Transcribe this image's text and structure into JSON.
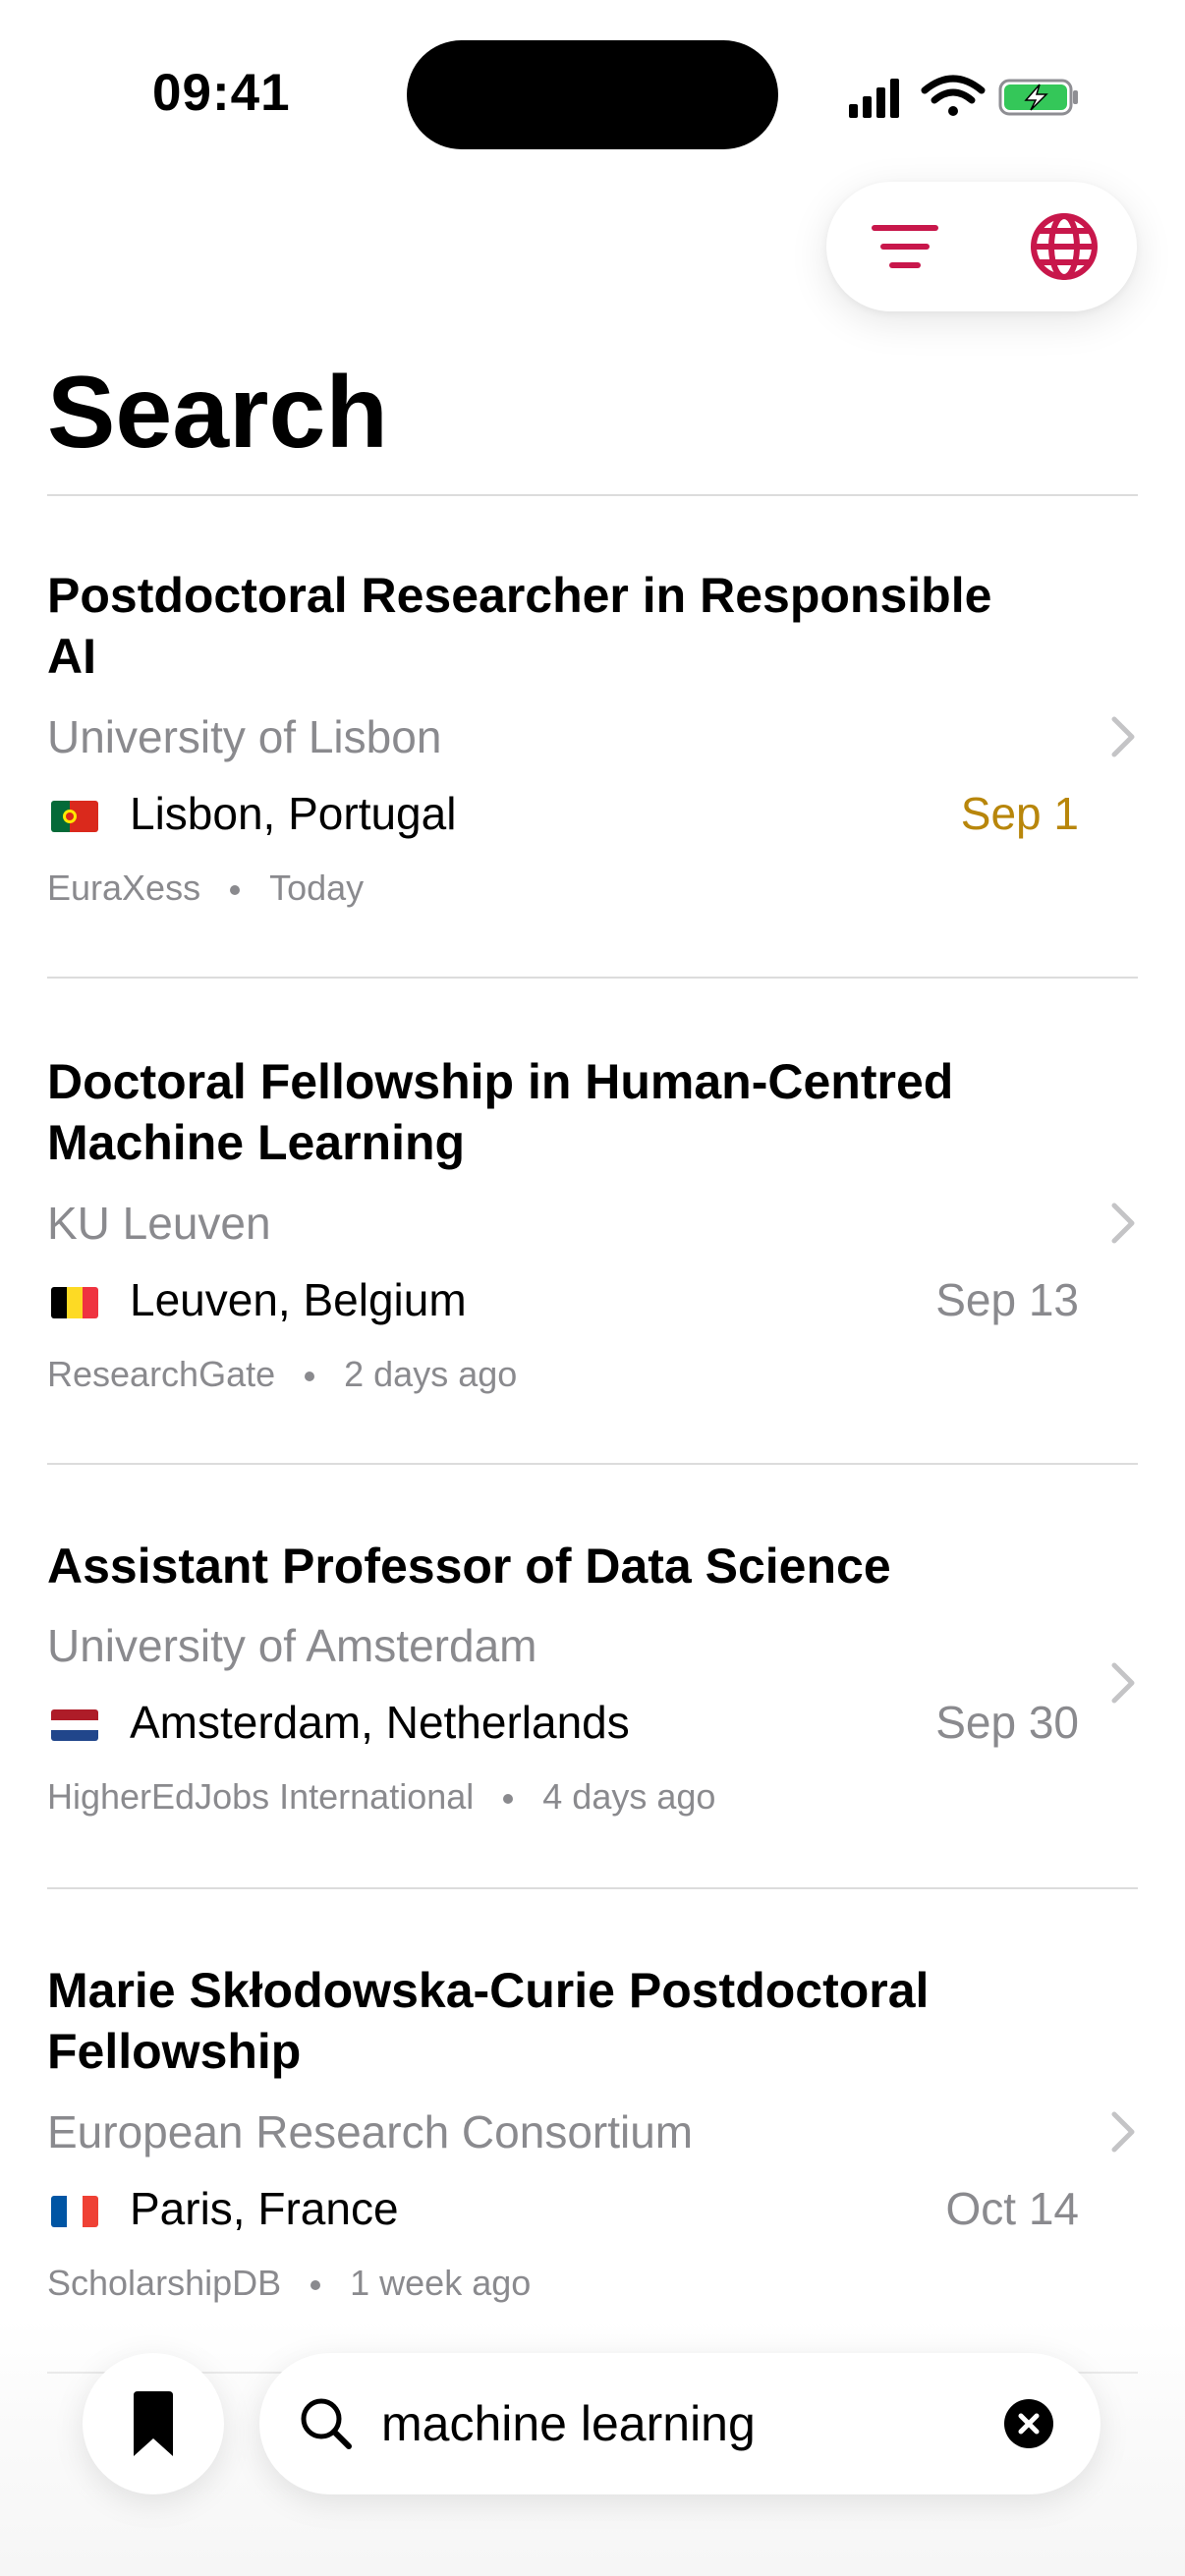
{
  "status_bar": {
    "time": "09:41"
  },
  "toolbar": {
    "filter_icon": "filter-lines-icon",
    "globe_icon": "globe-icon",
    "accent_color": "#c8174b"
  },
  "page": {
    "title": "Search"
  },
  "jobs": [
    {
      "title": "Postdoctoral Researcher in Responsible AI",
      "institution": "University of Lisbon",
      "location": "Lisbon, Portugal",
      "deadline": "Sep 1",
      "source": "EuraXess",
      "posted": "Today"
    },
    {
      "title": "Doctoral Fellowship in Human-Centred Machine Learning",
      "institution": "KU Leuven",
      "location": "Leuven, Belgium",
      "deadline": "Sep 13",
      "source": "ResearchGate",
      "posted": "2 days ago"
    },
    {
      "title": "Assistant Professor of Data Science",
      "institution": "University of Amsterdam",
      "location": "Amsterdam, Netherlands",
      "deadline": "Sep 30",
      "source": "HigherEdJobs International",
      "posted": "4 days ago"
    },
    {
      "title": "Marie Skłodowska-Curie Postdoctoral Fellowship",
      "institution": "European Research Consortium",
      "location": "Paris, France",
      "deadline": "Oct 14",
      "source": "ScholarshipDB",
      "posted": "1 week ago"
    }
  ],
  "colors": {
    "urgent_deadline": "#b8860b",
    "secondary_text": "#8a8a8e"
  },
  "search": {
    "value": "machine learning"
  }
}
